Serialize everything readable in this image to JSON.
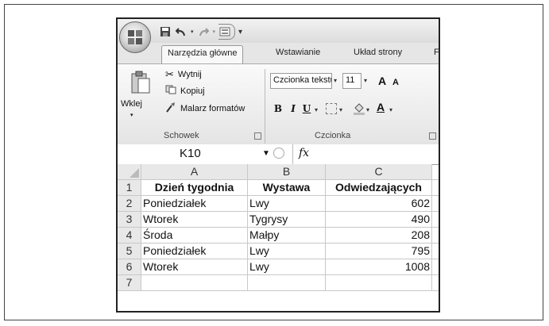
{
  "quick_access": {
    "separator": "▾"
  },
  "tabs": [
    {
      "label": "Narzędzia główne",
      "active": true
    },
    {
      "label": "Wstawianie",
      "active": false
    },
    {
      "label": "Układ strony",
      "active": false
    },
    {
      "label": "F",
      "active": false
    }
  ],
  "ribbon": {
    "clipboard": {
      "paste_label": "Wklej",
      "cut_label": "Wytnij",
      "copy_label": "Kopiuj",
      "format_painter_label": "Malarz formatów",
      "group_label": "Schowek"
    },
    "font": {
      "font_name": "Czcionka tekstu",
      "font_size": "11",
      "grow_label": "A",
      "shrink_label": "A",
      "bold_label": "B",
      "italic_label": "I",
      "underline_label": "U",
      "color_label": "A",
      "group_label": "Czcionka"
    }
  },
  "formula_bar": {
    "name_box": "K10",
    "fx_label": "fx",
    "formula": ""
  },
  "sheet": {
    "columns": [
      "A",
      "B",
      "C"
    ],
    "rows": [
      {
        "n": "1",
        "a": "Dzień tygodnia",
        "b": "Wystawa",
        "c": "Odwiedzających"
      },
      {
        "n": "2",
        "a": "Poniedziałek",
        "b": "Lwy",
        "c": "602"
      },
      {
        "n": "3",
        "a": "Wtorek",
        "b": "Tygrysy",
        "c": "490"
      },
      {
        "n": "4",
        "a": "Środa",
        "b": "Małpy",
        "c": "208"
      },
      {
        "n": "5",
        "a": "Poniedziałek",
        "b": "Lwy",
        "c": "795"
      },
      {
        "n": "6",
        "a": "Wtorek",
        "b": "Lwy",
        "c": "1008"
      },
      {
        "n": "7",
        "a": "",
        "b": "",
        "c": ""
      }
    ]
  }
}
